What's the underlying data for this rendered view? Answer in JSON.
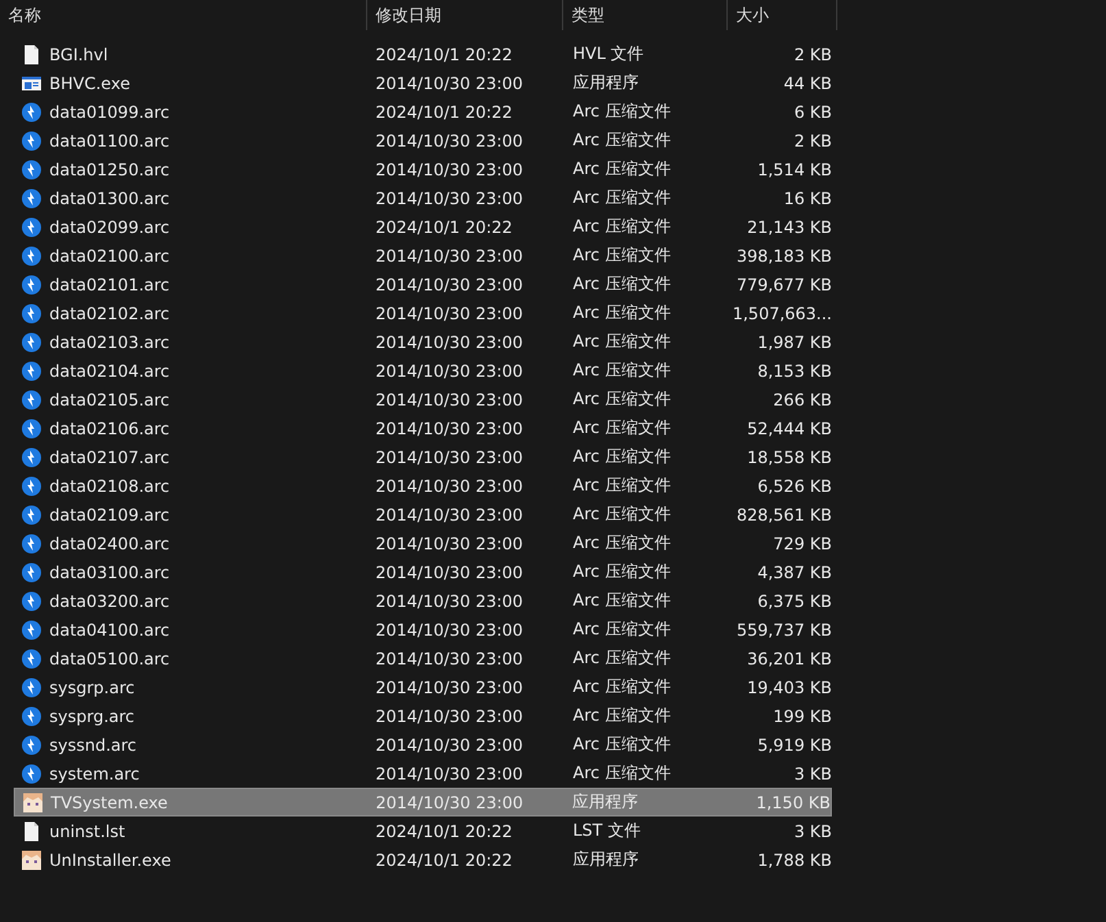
{
  "columns": [
    "名称",
    "修改日期",
    "类型",
    "大小"
  ],
  "rows": [
    {
      "name": "BGI.hvl",
      "date": "2024/10/1 20:22",
      "type": "HVL 文件",
      "size": "2 KB",
      "kind": "file",
      "selected": false
    },
    {
      "name": "BHVC.exe",
      "date": "2014/10/30 23:00",
      "type": "应用程序",
      "size": "44 KB",
      "kind": "app",
      "selected": false
    },
    {
      "name": "data01099.arc",
      "date": "2024/10/1 20:22",
      "type": "Arc 压缩文件",
      "size": "6 KB",
      "kind": "arc",
      "selected": false
    },
    {
      "name": "data01100.arc",
      "date": "2014/10/30 23:00",
      "type": "Arc 压缩文件",
      "size": "2 KB",
      "kind": "arc",
      "selected": false
    },
    {
      "name": "data01250.arc",
      "date": "2014/10/30 23:00",
      "type": "Arc 压缩文件",
      "size": "1,514 KB",
      "kind": "arc",
      "selected": false
    },
    {
      "name": "data01300.arc",
      "date": "2014/10/30 23:00",
      "type": "Arc 压缩文件",
      "size": "16 KB",
      "kind": "arc",
      "selected": false
    },
    {
      "name": "data02099.arc",
      "date": "2024/10/1 20:22",
      "type": "Arc 压缩文件",
      "size": "21,143 KB",
      "kind": "arc",
      "selected": false
    },
    {
      "name": "data02100.arc",
      "date": "2014/10/30 23:00",
      "type": "Arc 压缩文件",
      "size": "398,183 KB",
      "kind": "arc",
      "selected": false
    },
    {
      "name": "data02101.arc",
      "date": "2014/10/30 23:00",
      "type": "Arc 压缩文件",
      "size": "779,677 KB",
      "kind": "arc",
      "selected": false
    },
    {
      "name": "data02102.arc",
      "date": "2014/10/30 23:00",
      "type": "Arc 压缩文件",
      "size": "1,507,663...",
      "kind": "arc",
      "selected": false
    },
    {
      "name": "data02103.arc",
      "date": "2014/10/30 23:00",
      "type": "Arc 压缩文件",
      "size": "1,987 KB",
      "kind": "arc",
      "selected": false
    },
    {
      "name": "data02104.arc",
      "date": "2014/10/30 23:00",
      "type": "Arc 压缩文件",
      "size": "8,153 KB",
      "kind": "arc",
      "selected": false
    },
    {
      "name": "data02105.arc",
      "date": "2014/10/30 23:00",
      "type": "Arc 压缩文件",
      "size": "266 KB",
      "kind": "arc",
      "selected": false
    },
    {
      "name": "data02106.arc",
      "date": "2014/10/30 23:00",
      "type": "Arc 压缩文件",
      "size": "52,444 KB",
      "kind": "arc",
      "selected": false
    },
    {
      "name": "data02107.arc",
      "date": "2014/10/30 23:00",
      "type": "Arc 压缩文件",
      "size": "18,558 KB",
      "kind": "arc",
      "selected": false
    },
    {
      "name": "data02108.arc",
      "date": "2014/10/30 23:00",
      "type": "Arc 压缩文件",
      "size": "6,526 KB",
      "kind": "arc",
      "selected": false
    },
    {
      "name": "data02109.arc",
      "date": "2014/10/30 23:00",
      "type": "Arc 压缩文件",
      "size": "828,561 KB",
      "kind": "arc",
      "selected": false
    },
    {
      "name": "data02400.arc",
      "date": "2014/10/30 23:00",
      "type": "Arc 压缩文件",
      "size": "729 KB",
      "kind": "arc",
      "selected": false
    },
    {
      "name": "data03100.arc",
      "date": "2014/10/30 23:00",
      "type": "Arc 压缩文件",
      "size": "4,387 KB",
      "kind": "arc",
      "selected": false
    },
    {
      "name": "data03200.arc",
      "date": "2014/10/30 23:00",
      "type": "Arc 压缩文件",
      "size": "6,375 KB",
      "kind": "arc",
      "selected": false
    },
    {
      "name": "data04100.arc",
      "date": "2014/10/30 23:00",
      "type": "Arc 压缩文件",
      "size": "559,737 KB",
      "kind": "arc",
      "selected": false
    },
    {
      "name": "data05100.arc",
      "date": "2014/10/30 23:00",
      "type": "Arc 压缩文件",
      "size": "36,201 KB",
      "kind": "arc",
      "selected": false
    },
    {
      "name": "sysgrp.arc",
      "date": "2014/10/30 23:00",
      "type": "Arc 压缩文件",
      "size": "19,403 KB",
      "kind": "arc",
      "selected": false
    },
    {
      "name": "sysprg.arc",
      "date": "2014/10/30 23:00",
      "type": "Arc 压缩文件",
      "size": "199 KB",
      "kind": "arc",
      "selected": false
    },
    {
      "name": "syssnd.arc",
      "date": "2014/10/30 23:00",
      "type": "Arc 压缩文件",
      "size": "5,919 KB",
      "kind": "arc",
      "selected": false
    },
    {
      "name": "system.arc",
      "date": "2014/10/30 23:00",
      "type": "Arc 压缩文件",
      "size": "3 KB",
      "kind": "arc",
      "selected": false
    },
    {
      "name": "TVSystem.exe",
      "date": "2014/10/30 23:00",
      "type": "应用程序",
      "size": "1,150 KB",
      "kind": "character",
      "selected": true
    },
    {
      "name": "uninst.lst",
      "date": "2024/10/1 20:22",
      "type": "LST 文件",
      "size": "3 KB",
      "kind": "file",
      "selected": false
    },
    {
      "name": "UnInstaller.exe",
      "date": "2024/10/1 20:22",
      "type": "应用程序",
      "size": "1,788 KB",
      "kind": "character",
      "selected": false
    }
  ]
}
